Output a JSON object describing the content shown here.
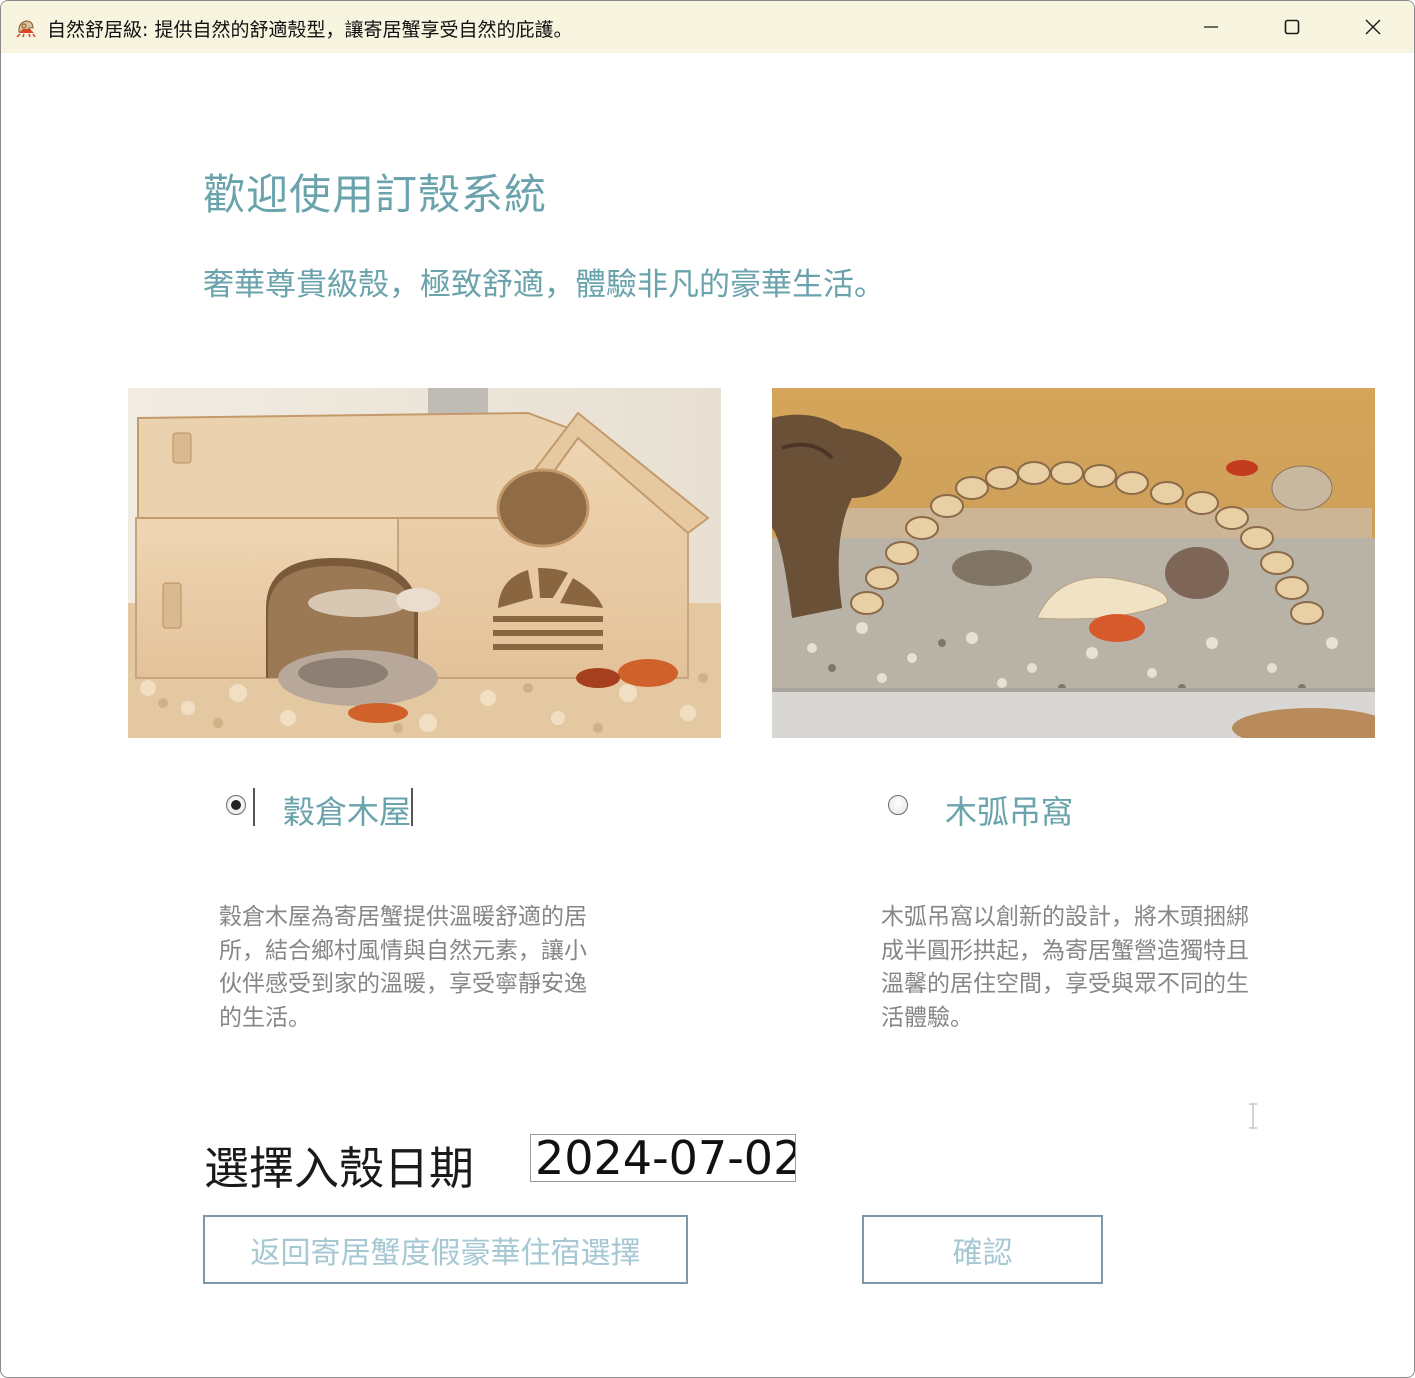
{
  "window": {
    "title": "自然舒居級: 提供自然的舒適殼型，讓寄居蟹享受自然的庇護。",
    "icon": "hermit-crab-app-icon",
    "controls": [
      "minimize-icon",
      "maximize-icon",
      "close-icon"
    ]
  },
  "header": {
    "title": "歡迎使用訂殼系統",
    "subtitle": "奢華尊貴級殼，極致舒適，體驗非凡的豪華生活。"
  },
  "options": [
    {
      "label": "穀倉木屋",
      "selected": true,
      "image": "wooden-barn-house-photo",
      "description": "穀倉木屋為寄居蟹提供溫暖舒適的居所，結合鄉村風情與自然元素，讓小伙伴感受到家的溫暖，享受寧靜安逸的生活。"
    },
    {
      "label": "木弧吊窩",
      "selected": false,
      "image": "wooden-arch-bridge-photo",
      "description": "木弧吊窩以創新的設計，將木頭捆綁成半圓形拱起，為寄居蟹營造獨特且溫馨的居住空間，享受與眾不同的生活體驗。"
    }
  ],
  "date": {
    "label": "選擇入殼日期",
    "value": "2024-07-02"
  },
  "buttons": {
    "back": "返回寄居蟹度假豪華住宿選擇",
    "confirm": "確認"
  },
  "colors": {
    "accent_text": "#6aa3ac",
    "titlebar_bg": "#f7f4e0",
    "description_text": "#868686",
    "button_text": "#a6c8d3",
    "button_border": "#7e98a8"
  }
}
